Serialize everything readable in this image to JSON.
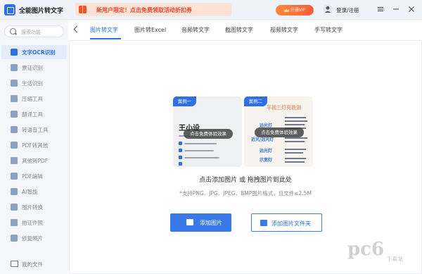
{
  "app": {
    "title": "全能图片转文字",
    "promo_text": "新用户限定！点击免费领取活动折扣券",
    "vip_label": "开通VIP",
    "login_label": "登录/注册",
    "accent_color": "#2f6fe4"
  },
  "sidebar": {
    "search_placeholder": "搜索功能",
    "items": [
      {
        "label": "文字OCR识别",
        "icon": "text-ocr-icon",
        "active": true
      },
      {
        "label": "票证识别",
        "icon": "ticket-icon",
        "active": false
      },
      {
        "label": "生活识别",
        "icon": "life-icon",
        "active": false
      },
      {
        "label": "压缩工具",
        "icon": "compress-icon",
        "active": false
      },
      {
        "label": "翻译工具",
        "icon": "translate-icon",
        "active": false
      },
      {
        "label": "转语音工具",
        "icon": "speech-icon",
        "active": false
      },
      {
        "label": "PDF转其他",
        "icon": "pdf-icon",
        "active": false
      },
      {
        "label": "其他转PDF",
        "icon": "to-pdf-icon",
        "active": false
      },
      {
        "label": "PDF编辑",
        "icon": "pdf-edit-icon",
        "active": false
      },
      {
        "label": "AI智能",
        "icon": "ai-icon",
        "active": false
      },
      {
        "label": "图片转换",
        "icon": "image-convert-icon",
        "active": false
      },
      {
        "label": "拍证件照",
        "icon": "id-photo-icon",
        "active": false
      },
      {
        "label": "修复照片",
        "icon": "photo-repair-icon",
        "active": false
      }
    ],
    "bottom_label": "我的文件"
  },
  "tabs": [
    {
      "label": "图片转文字",
      "active": true
    },
    {
      "label": "图片转Excel",
      "active": false
    },
    {
      "label": "音频转文字",
      "active": false
    },
    {
      "label": "截图转文字",
      "active": false
    },
    {
      "label": "视频转文字",
      "active": false
    },
    {
      "label": "手写转文字",
      "active": false
    }
  ],
  "main": {
    "case1": {
      "tag": "案例一",
      "name": "王小设",
      "overlay": "点击免费体验效果"
    },
    "case2": {
      "tag": "案例二",
      "title": "平视三灯亮拨测",
      "left_labels": [
        "远光灯",
        "近光/远光灯",
        "远光灯",
        "示宽灯"
      ],
      "overlay": "点击免费体验效果"
    },
    "hint_main": "点击添加图片 或 拖拽图片到此处",
    "hint_sub": "*支持PNG、JPG、JPEG、BMP图片格式，且文件≤2.5M",
    "add_image_label": "添加图片",
    "add_folder_label": "添加图片文件夹"
  }
}
